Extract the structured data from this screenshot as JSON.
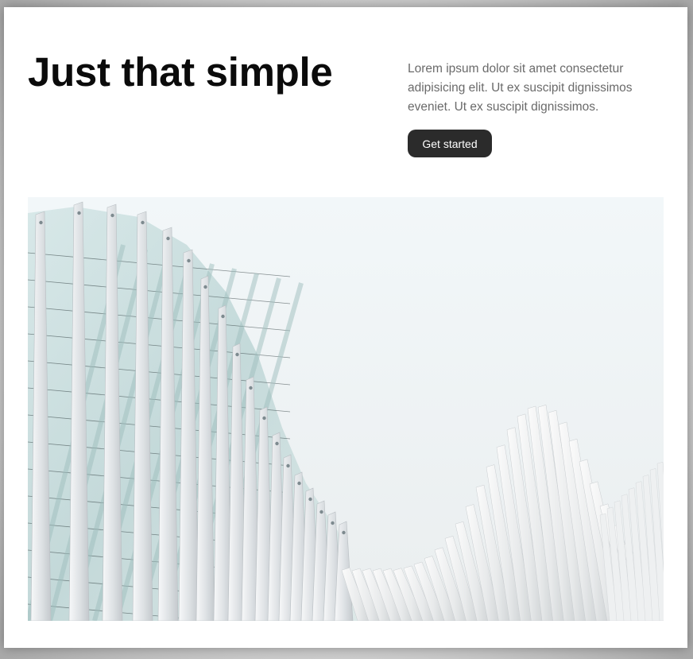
{
  "hero_section": {
    "headline": "Just that simple",
    "intro_text": "Lorem ipsum dolor sit amet consectetur adipisicing elit. Ut ex suscipit dignissimos eveniet. Ut ex suscipit dignissimos.",
    "cta_label": "Get started",
    "cta_color": "#2b2b2b"
  },
  "image": {
    "subject": "white-wave-architecture-photo"
  }
}
